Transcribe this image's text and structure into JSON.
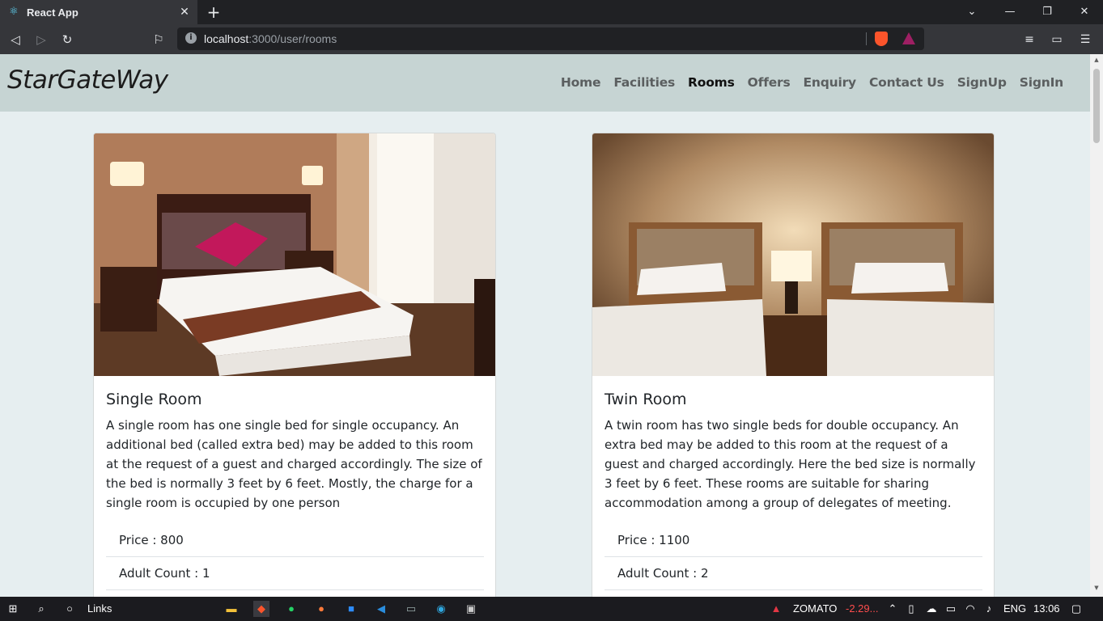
{
  "browser": {
    "tab_title": "React App",
    "url_host": "localhost",
    "url_path": ":3000/user/rooms"
  },
  "site": {
    "brand": "StarGateWay",
    "nav": [
      {
        "label": "Home",
        "active": false
      },
      {
        "label": "Facilities",
        "active": false
      },
      {
        "label": "Rooms",
        "active": true
      },
      {
        "label": "Offers",
        "active": false
      },
      {
        "label": "Enquiry",
        "active": false
      },
      {
        "label": "Contact Us",
        "active": false
      },
      {
        "label": "SignUp",
        "active": false
      },
      {
        "label": "SignIn",
        "active": false
      }
    ]
  },
  "rooms": [
    {
      "title": "Single Room",
      "description": "A single room has one single bed for single occupancy. An additional bed (called extra bed) may be added to this room at the request of a guest and charged accordingly. The size of the bed is normally 3 feet by 6 feet. Mostly, the charge for a single room is occupied by one person",
      "price": "Price : 800",
      "adult_count": "Adult Count : 1"
    },
    {
      "title": "Twin Room",
      "description": "A twin room has two single beds for double occupancy. An extra bed may be added to this room at the request of a guest and charged accordingly. Here the bed size is normally 3 feet by 6 feet. These rooms are suitable for sharing accommodation among a group of delegates of meeting.",
      "price": "Price : 1100",
      "adult_count": "Adult Count : 2"
    }
  ],
  "taskbar": {
    "search_label": "Links",
    "stock_name": "ZOMATO",
    "stock_change": "-2.29...",
    "language": "ENG",
    "time": "13:06"
  },
  "colors": {
    "navbar_bg": "#c6d4d3",
    "page_bg": "#e6eef0",
    "stock_down": "#ff4d4d"
  }
}
